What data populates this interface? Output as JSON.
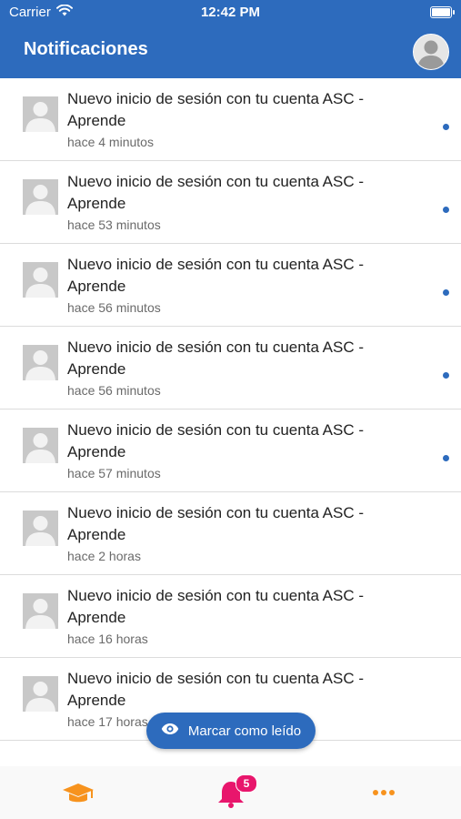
{
  "status_bar": {
    "carrier": "Carrier",
    "time": "12:42 PM"
  },
  "header": {
    "title": "Notificaciones",
    "avatar_icon": "user-avatar-icon"
  },
  "notifications": [
    {
      "title": "Nuevo inicio de sesión con tu cuenta ASC - Aprende",
      "time": "hace 4 minutos",
      "unread": true
    },
    {
      "title": "Nuevo inicio de sesión con tu cuenta ASC - Aprende",
      "time": "hace 53 minutos",
      "unread": true
    },
    {
      "title": "Nuevo inicio de sesión con tu cuenta ASC - Aprende",
      "time": "hace 56 minutos",
      "unread": true
    },
    {
      "title": "Nuevo inicio de sesión con tu cuenta ASC - Aprende",
      "time": "hace 56 minutos",
      "unread": true
    },
    {
      "title": "Nuevo inicio de sesión con tu cuenta ASC - Aprende",
      "time": "hace 57 minutos",
      "unread": true
    },
    {
      "title": "Nuevo inicio de sesión con tu cuenta ASC - Aprende",
      "time": "hace 2 horas",
      "unread": false
    },
    {
      "title": "Nuevo inicio de sesión con tu cuenta ASC - Aprende",
      "time": "hace 16 horas",
      "unread": false
    },
    {
      "title": "Nuevo inicio de sesión con tu cuenta ASC - Aprende",
      "time": "hace 17 horas",
      "unread": false
    }
  ],
  "mark_read_button": {
    "label": "Marcar como leído",
    "icon": "eye-icon"
  },
  "tab_bar": {
    "courses_icon": "graduation-cap-icon",
    "notifications_icon": "bell-icon",
    "notifications_badge": "5",
    "more_icon": "more-dots-icon"
  },
  "colors": {
    "primary": "#2d6bbd",
    "accent_orange": "#f7931e",
    "accent_pink": "#e8166c",
    "unread_dot": "#2d6bbd"
  }
}
